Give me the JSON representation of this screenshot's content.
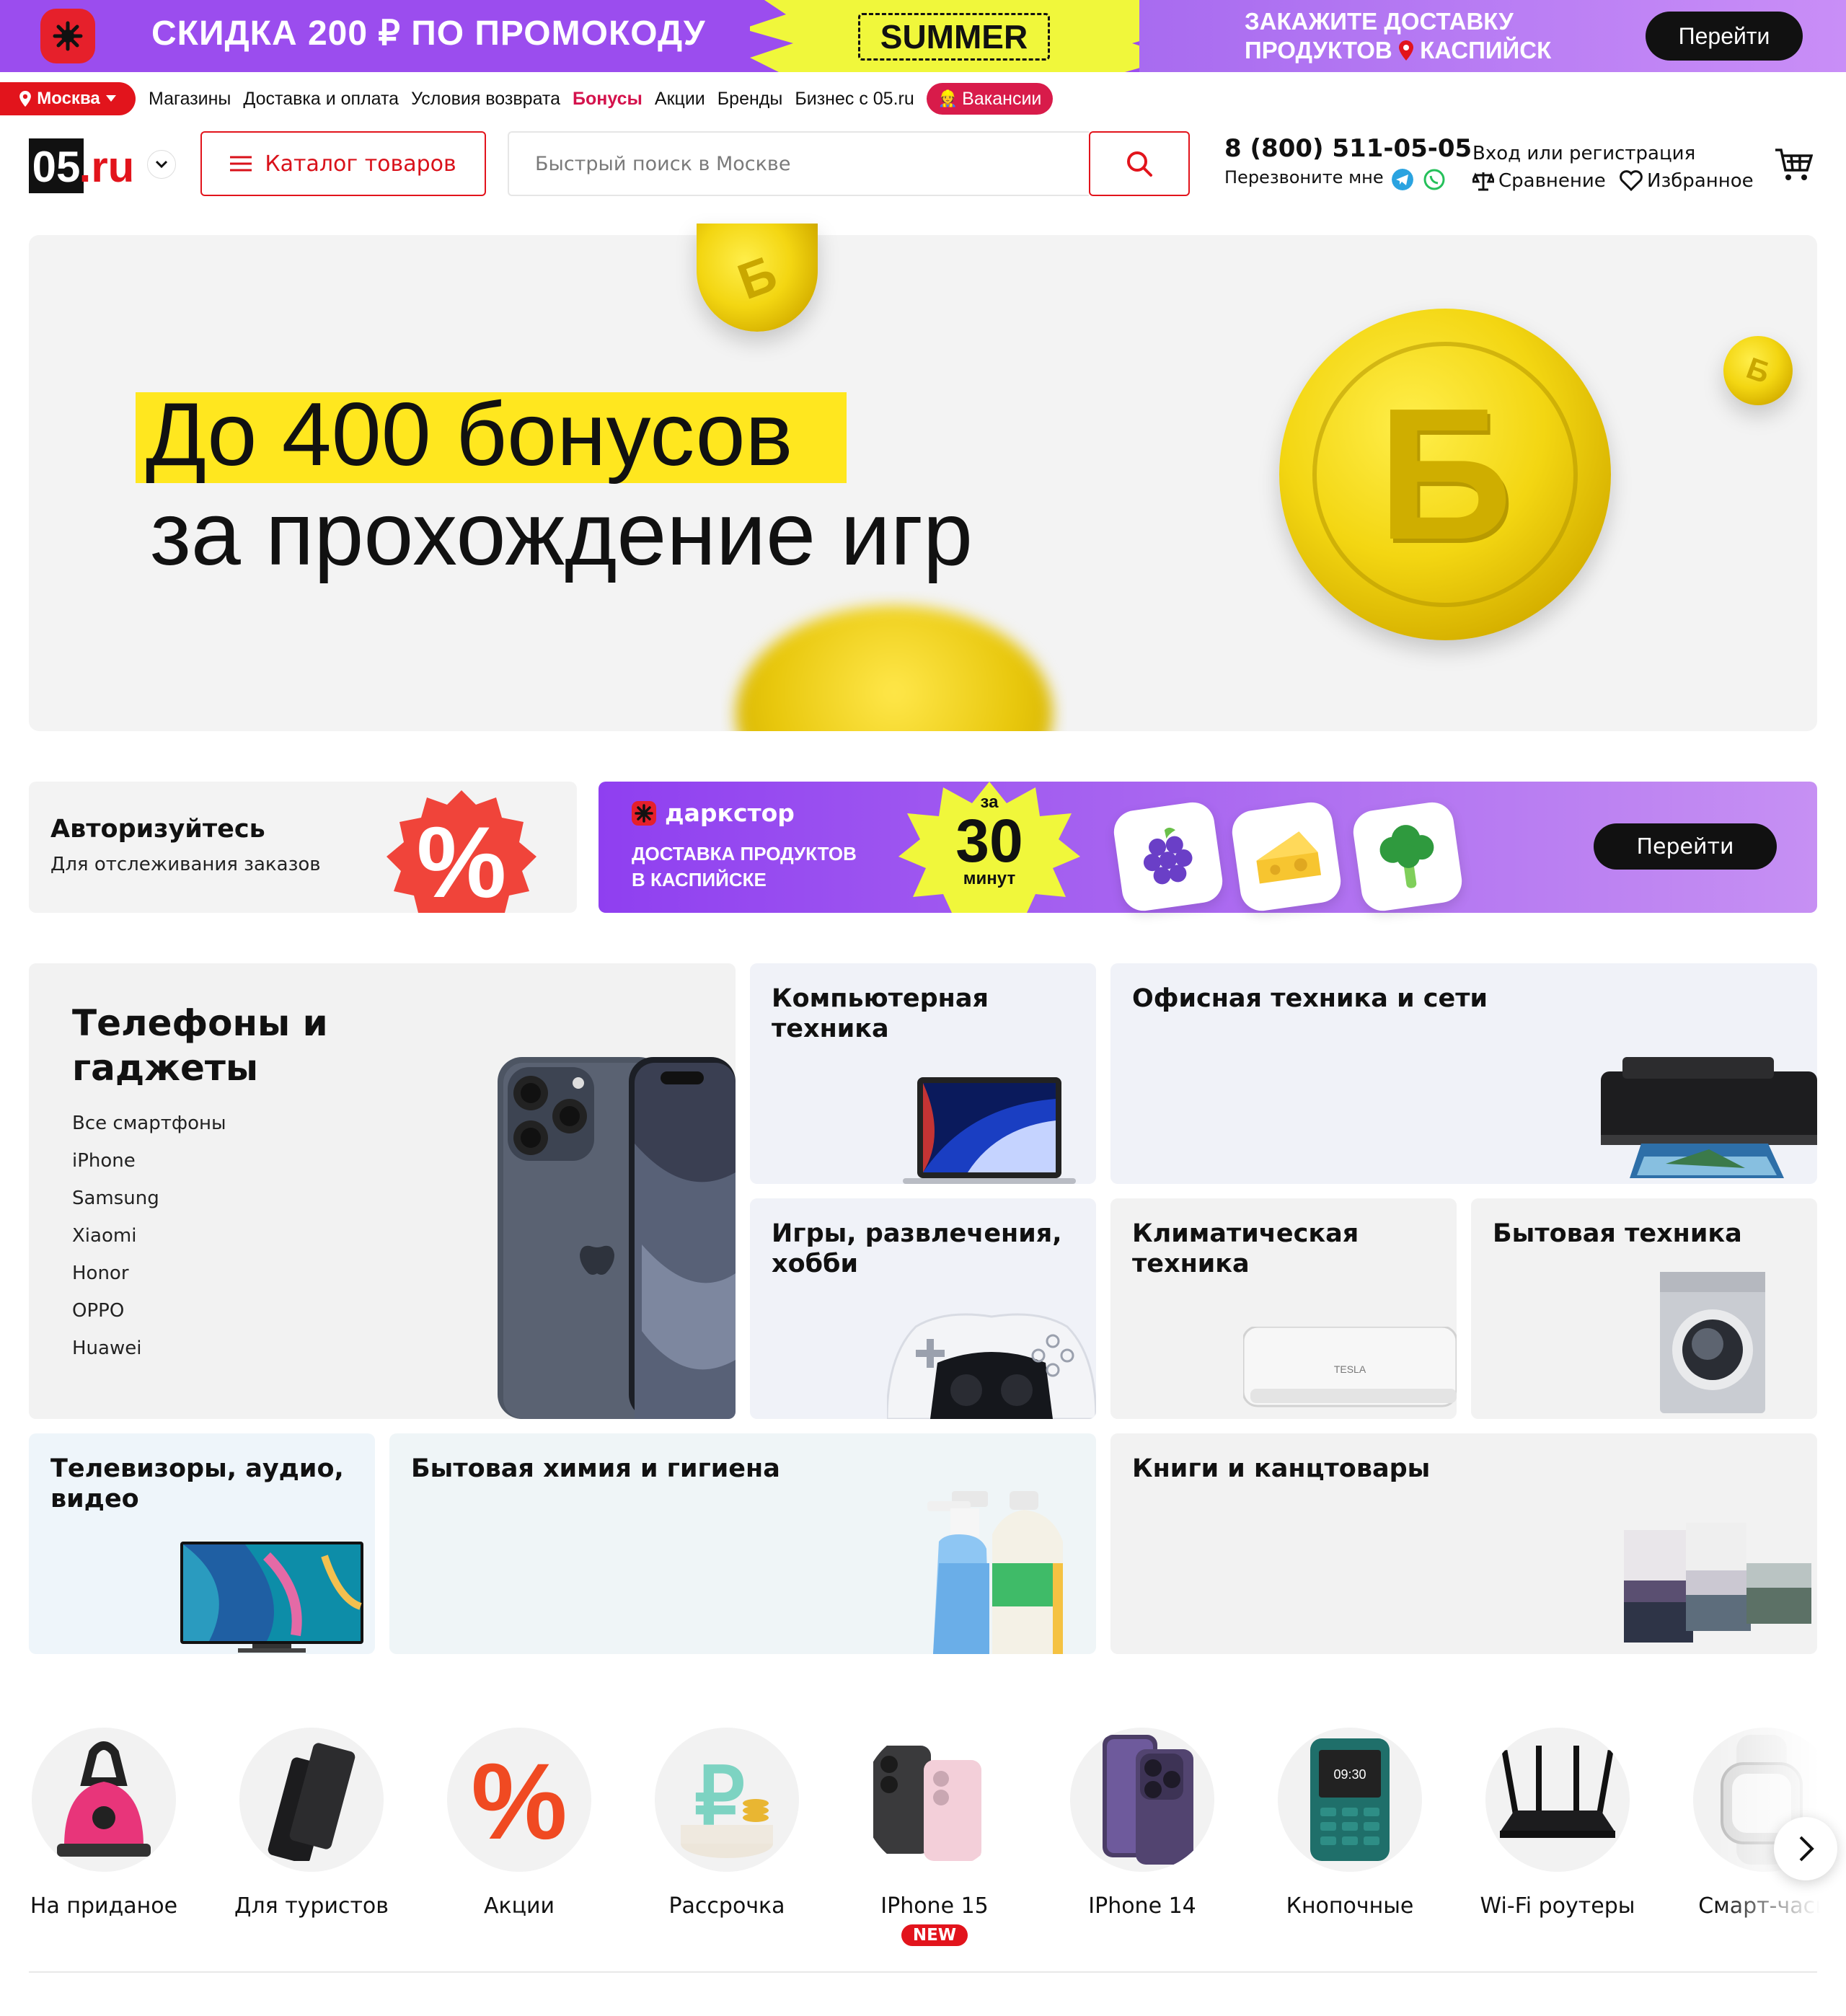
{
  "promo": {
    "text": "СКИДКА 200 ₽ ПО ПРОМОКОДУ",
    "code": "SUMMER",
    "right_line1": "ЗАКАЖИТЕ ДОСТАВКУ",
    "right_line2a": "ПРОДУКТОВ",
    "right_line2b": "КАСПИЙСК",
    "button": "Перейти",
    "colors": {
      "bg": "#9b4dee",
      "code_bg": "#f0f73b",
      "badge": "#e6202b"
    }
  },
  "topnav": {
    "city": "Москва",
    "links": [
      "Магазины",
      "Доставка и оплата",
      "Условия возврата",
      "Бонусы",
      "Акции",
      "Бренды",
      "Бизнес с 05.ru"
    ],
    "vacancies": "Вакансии"
  },
  "header": {
    "logo": "05.ru",
    "catalog": "Каталог товаров",
    "search_placeholder": "Быстрый поиск в Москве",
    "phone": "8 (800) 511-05-05",
    "callback": "Перезвоните мне",
    "login": "Вход или регистрация",
    "compare": "Сравнение",
    "favorites": "Избранное"
  },
  "hero": {
    "line1": "До 400 бонусов",
    "line2": "за прохождение игр",
    "coin_letter": "Б",
    "highlight_color": "#ffe71f"
  },
  "auth_card": {
    "title": "Авторизуйтесь",
    "subtitle": "Для отслеживания заказов"
  },
  "darkstore": {
    "logo": "даркстор",
    "subtitle_line1": "ДОСТАВКА ПРОДУКТОВ",
    "subtitle_line2": "В КАСПИЙСКЕ",
    "badge_top": "за",
    "badge_num": "30",
    "badge_bottom": "минут",
    "button": "Перейти"
  },
  "categories": {
    "phones": {
      "title": "Телефоны и гаджеты",
      "links": [
        "Все смартфоны",
        "iPhone",
        "Samsung",
        "Xiaomi",
        "Honor",
        "OPPO",
        "Huawei"
      ]
    },
    "computer": "Компьютерная техника",
    "office": "Офисная техника и сети",
    "games": "Игры, развлечения, хобби",
    "climate": "Климатическая техника",
    "appliances": "Бытовая техника",
    "tv": "Телевизоры, аудио, видео",
    "chemistry": "Бытовая химия и гигиена",
    "books": "Книги и канцтовары"
  },
  "circles": [
    {
      "label": "На приданое",
      "icon": "steam-iron-icon"
    },
    {
      "label": "Для туристов",
      "icon": "powerbank-icon"
    },
    {
      "label": "Акции",
      "icon": "percent-icon"
    },
    {
      "label": "Рассрочка",
      "icon": "ruble-icon"
    },
    {
      "label": "IPhone 15",
      "icon": "iphone15-icon",
      "badge": "NEW"
    },
    {
      "label": "IPhone 14",
      "icon": "iphone14-icon"
    },
    {
      "label": "Кнопочные",
      "icon": "button-phone-icon"
    },
    {
      "label": "Wi-Fi роутеры",
      "icon": "router-icon"
    },
    {
      "label": "Смарт-часы",
      "icon": "smartwatch-icon"
    }
  ]
}
